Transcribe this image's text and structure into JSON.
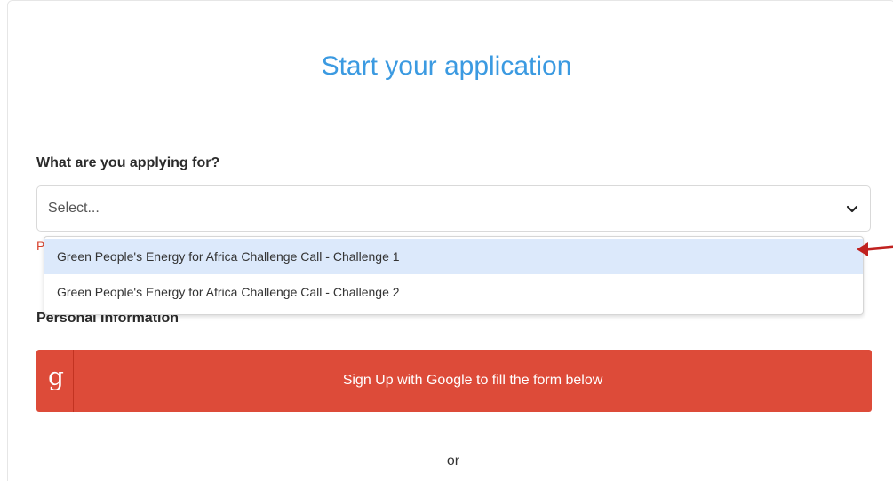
{
  "form": {
    "title": "Start your application",
    "question_label": "What are you applying for?",
    "select": {
      "placeholder": "Select...",
      "icon": "chevron-down-icon",
      "options": [
        {
          "label": "Green People's Energy for Africa Challenge Call - Challenge 1",
          "highlighted": true
        },
        {
          "label": "Green People's Energy for Africa Challenge Call - Challenge 2",
          "highlighted": false
        }
      ]
    },
    "error_letter": "P",
    "personal_section_title": "Personal Information",
    "google_button": {
      "icon_letter": "g",
      "label": "Sign Up with Google to fill the form below",
      "color": "#dd4b39"
    },
    "or_text": "or"
  },
  "colors": {
    "title": "#3b9ae1",
    "highlight": "#dce9fb",
    "annotation_arrow": "#c0211f",
    "error": "#d9432f"
  }
}
